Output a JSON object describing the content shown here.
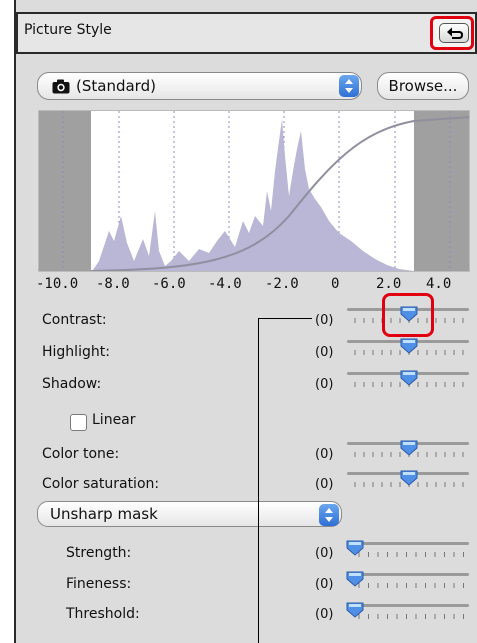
{
  "header": {
    "title": "Picture Style"
  },
  "style_select": {
    "value": "(Standard)"
  },
  "browse_button": {
    "label": "Browse..."
  },
  "graph": {
    "x_ticks": [
      "-10.0",
      "-8.0",
      "-6.0",
      "-4.0",
      "-2.0",
      "0",
      "2.0",
      "4.0"
    ],
    "colors": {
      "histogram": "#b9b6d6",
      "curve": "#8f8f9f",
      "shaded": "#9a9a9a"
    }
  },
  "adjustments": [
    {
      "label": "Contrast:",
      "value": "(0)",
      "level": 0
    },
    {
      "label": "Highlight:",
      "value": "(0)",
      "level": 0
    },
    {
      "label": "Shadow:",
      "value": "(0)",
      "level": 0
    }
  ],
  "linear": {
    "label": "Linear",
    "checked": false
  },
  "color_adjustments": [
    {
      "label": "Color tone:",
      "value": "(0)",
      "level": 0
    },
    {
      "label": "Color saturation:",
      "value": "(0)",
      "level": 0
    }
  ],
  "sharpness_select": {
    "value": "Unsharp mask"
  },
  "sharpness": [
    {
      "label": "Strength:",
      "value": "(0)",
      "level": 0
    },
    {
      "label": "Fineness:",
      "value": "(0)",
      "level": 0
    },
    {
      "label": "Threshold:",
      "value": "(0)",
      "level": 0
    }
  ],
  "accent": {
    "callout": "#e00010",
    "thumb": "#4f8fe6"
  }
}
